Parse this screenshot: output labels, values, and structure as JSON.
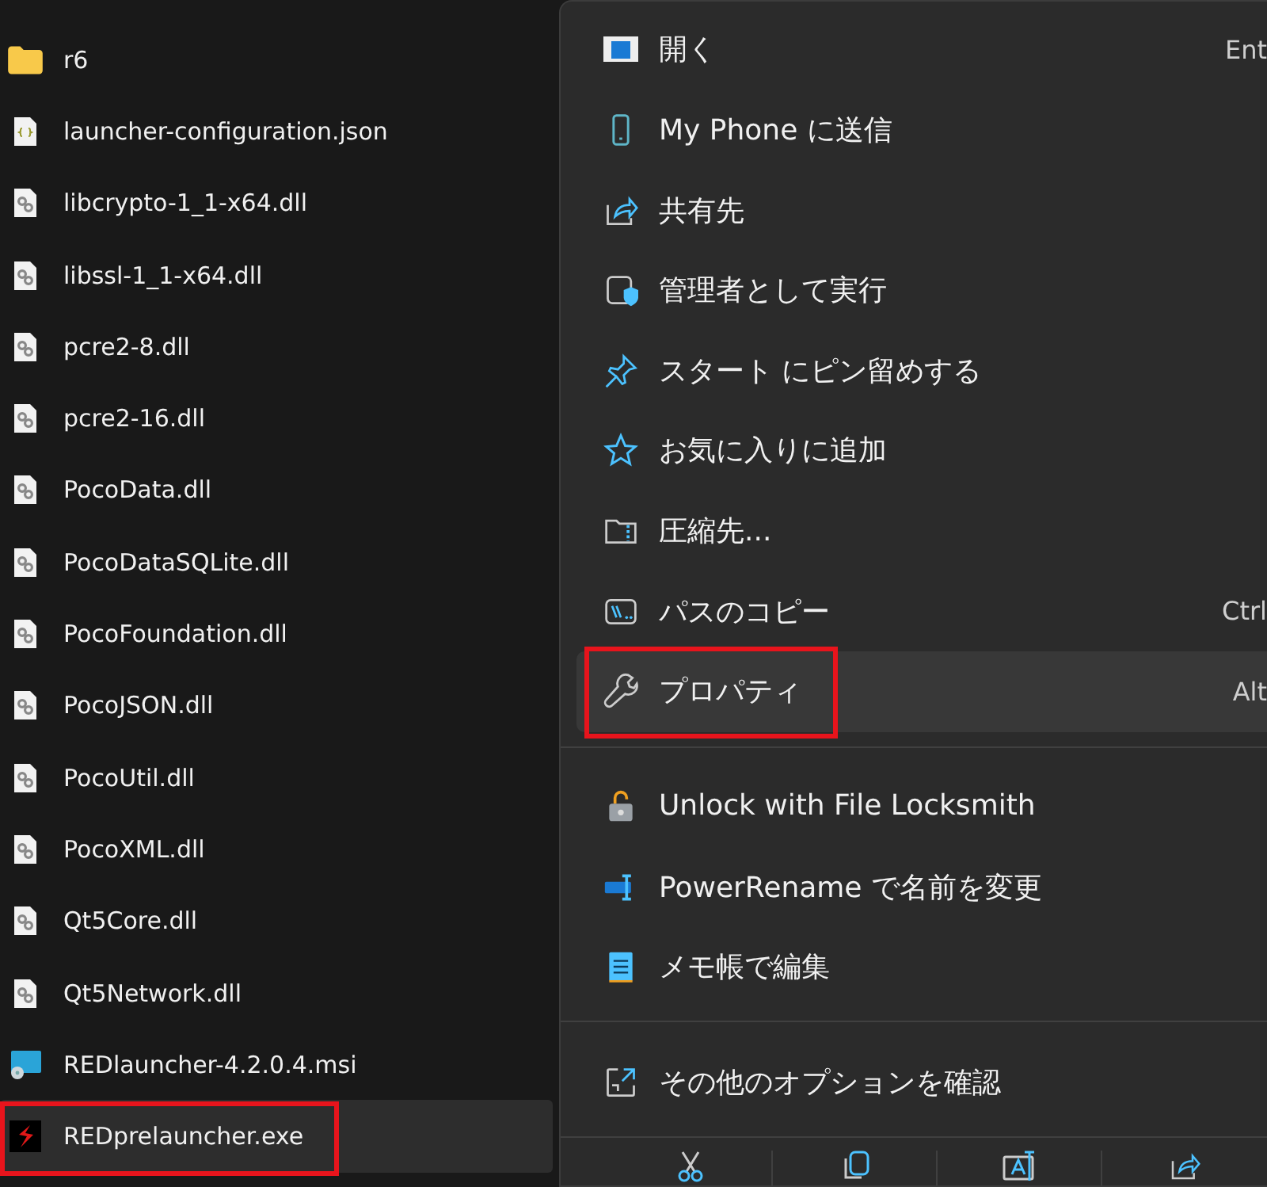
{
  "files": [
    {
      "name": "r6",
      "kind": "folder",
      "selected": false,
      "highlighted": false
    },
    {
      "name": "launcher-configuration.json",
      "kind": "json",
      "selected": false,
      "highlighted": false
    },
    {
      "name": "libcrypto-1_1-x64.dll",
      "kind": "dll",
      "selected": false,
      "highlighted": false
    },
    {
      "name": "libssl-1_1-x64.dll",
      "kind": "dll",
      "selected": false,
      "highlighted": false
    },
    {
      "name": "pcre2-8.dll",
      "kind": "dll",
      "selected": false,
      "highlighted": false
    },
    {
      "name": "pcre2-16.dll",
      "kind": "dll",
      "selected": false,
      "highlighted": false
    },
    {
      "name": "PocoData.dll",
      "kind": "dll",
      "selected": false,
      "highlighted": false
    },
    {
      "name": "PocoDataSQLite.dll",
      "kind": "dll",
      "selected": false,
      "highlighted": false
    },
    {
      "name": "PocoFoundation.dll",
      "kind": "dll",
      "selected": false,
      "highlighted": false
    },
    {
      "name": "PocoJSON.dll",
      "kind": "dll",
      "selected": false,
      "highlighted": false
    },
    {
      "name": "PocoUtil.dll",
      "kind": "dll",
      "selected": false,
      "highlighted": false
    },
    {
      "name": "PocoXML.dll",
      "kind": "dll",
      "selected": false,
      "highlighted": false
    },
    {
      "name": "Qt5Core.dll",
      "kind": "dll",
      "selected": false,
      "highlighted": false
    },
    {
      "name": "Qt5Network.dll",
      "kind": "dll",
      "selected": false,
      "highlighted": false
    },
    {
      "name": "REDlauncher-4.2.0.4.msi",
      "kind": "msi",
      "selected": false,
      "highlighted": false
    },
    {
      "name": "REDprelauncher.exe",
      "kind": "exe",
      "selected": true,
      "highlighted": true
    }
  ],
  "context_menu": {
    "sections": [
      [
        {
          "label": "開く",
          "shortcut": "Ent",
          "hovered": false,
          "highlighted": false
        },
        {
          "label": "My Phone に送信",
          "hovered": false,
          "highlighted": false
        },
        {
          "label": "共有先",
          "hovered": false,
          "highlighted": false
        },
        {
          "label": "管理者として実行",
          "hovered": false,
          "highlighted": false
        },
        {
          "label": "スタート にピン留めする",
          "hovered": false,
          "highlighted": false
        },
        {
          "label": "お気に入りに追加",
          "hovered": false,
          "highlighted": false
        },
        {
          "label": "圧縮先...",
          "hovered": false,
          "highlighted": false
        },
        {
          "label": "パスのコピー",
          "shortcut": "Ctrl",
          "hovered": false,
          "highlighted": false
        },
        {
          "label": "プロパティ",
          "shortcut": "Alt",
          "hovered": true,
          "highlighted": true
        }
      ],
      [
        {
          "label": "Unlock with File Locksmith",
          "hovered": false,
          "highlighted": false
        },
        {
          "label": "PowerRename で名前を変更",
          "hovered": false,
          "highlighted": false
        },
        {
          "label": "メモ帳で編集",
          "hovered": false,
          "highlighted": false
        }
      ],
      [
        {
          "label": "その他のオプションを確認",
          "hovered": false,
          "highlighted": false
        }
      ]
    ]
  }
}
